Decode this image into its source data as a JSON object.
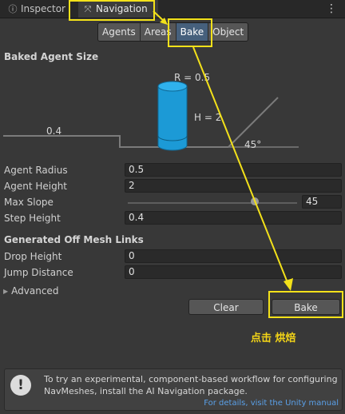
{
  "tabs": [
    {
      "label": "Inspector",
      "icon": "inspector-icon"
    },
    {
      "label": "Navigation",
      "icon": "navigation-icon",
      "active": true
    }
  ],
  "subtabs": [
    "Agents",
    "Areas",
    "Bake",
    "Object"
  ],
  "active_subtab": "Bake",
  "baked_agent_size": {
    "title": "Baked Agent Size",
    "diagram": {
      "radius_label": "R = 0.5",
      "height_label": "H = 2",
      "step_label": "0.4",
      "slope_label": "45°"
    },
    "fields": [
      {
        "label": "Agent Radius",
        "value": "0.5"
      },
      {
        "label": "Agent Height",
        "value": "2"
      }
    ],
    "max_slope": {
      "label": "Max Slope",
      "value": "45",
      "range": [
        0,
        60
      ]
    },
    "step_height": {
      "label": "Step Height",
      "value": "0.4"
    }
  },
  "off_mesh": {
    "title": "Generated Off Mesh Links",
    "fields": [
      {
        "label": "Drop Height",
        "value": "0"
      },
      {
        "label": "Jump Distance",
        "value": "0"
      }
    ]
  },
  "advanced_label": "Advanced",
  "buttons": {
    "clear": "Clear",
    "bake": "Bake"
  },
  "annotation": "点击 烘焙",
  "help": {
    "text": "To try an experimental, component-based workflow for configuring NavMeshes, install the AI Navigation package.",
    "link": "For details, visit the Unity manual"
  },
  "colors": {
    "highlight": "#f3e11a",
    "agent_cylinder": "#1c9ad6",
    "active_tab": "#46607c"
  }
}
